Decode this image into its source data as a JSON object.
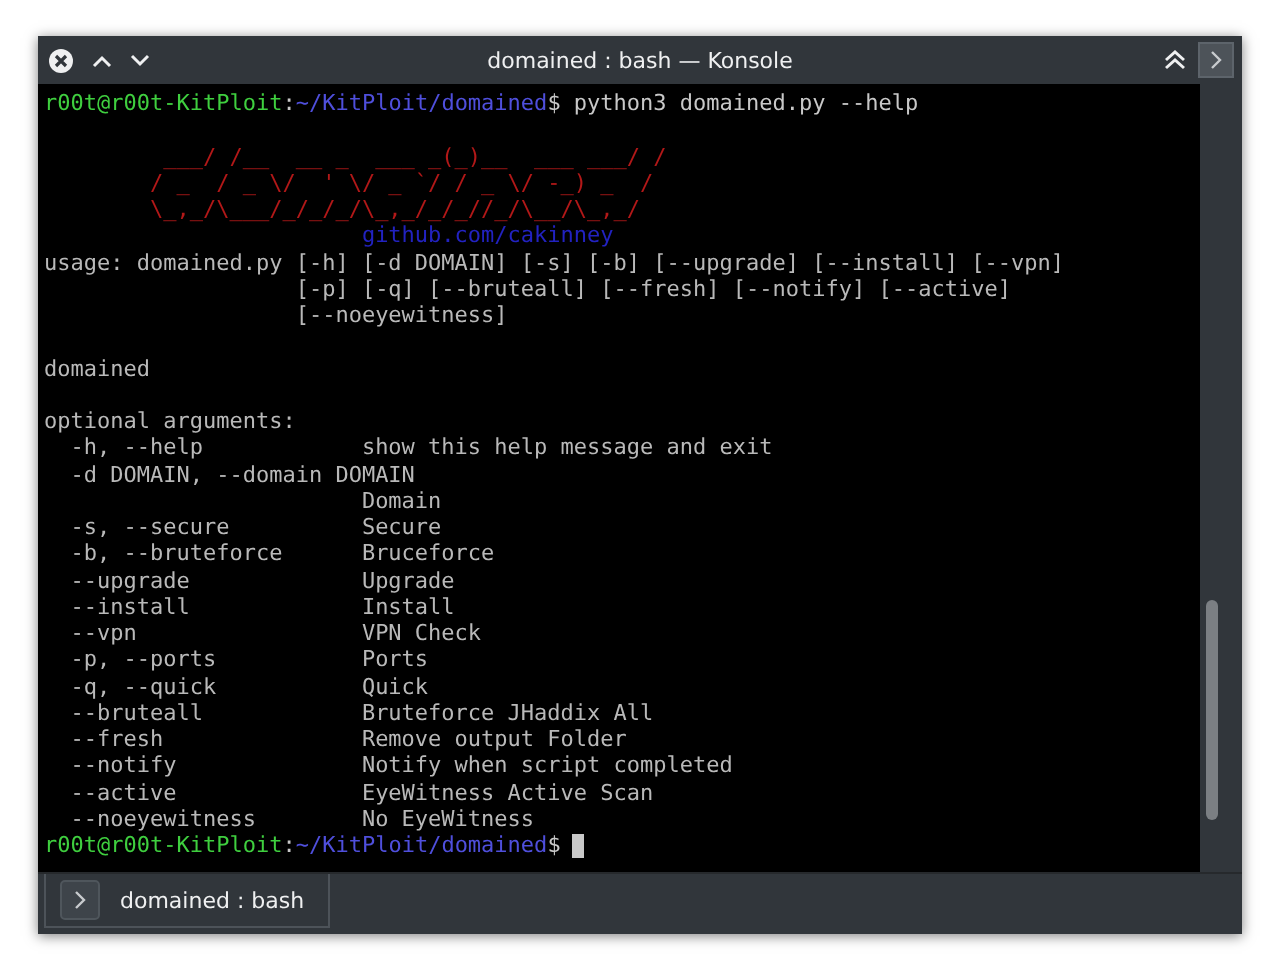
{
  "window": {
    "title": "domained : bash — Konsole"
  },
  "terminal": {
    "lines": [
      {
        "kind": "prompt",
        "segments": [
          {
            "kind": "user",
            "text": "r00t@r00t-KitPloit"
          },
          {
            "kind": "sep",
            "text": ":"
          },
          {
            "kind": "path",
            "text": "~/KitPloit/domained"
          },
          {
            "kind": "plain",
            "text": "$ python3 domained.py --help"
          }
        ]
      },
      {
        "kind": "blank"
      },
      {
        "kind": "art",
        "text": "         ___/ /__  __ _  ___ _(_)__  ___ ___/ /"
      },
      {
        "kind": "art",
        "text": "        / _  / _ \\/  ' \\/ _ `/ / _ \\/ -_) _  /"
      },
      {
        "kind": "art",
        "text": "        \\_,_/\\___/_/_/_/\\_,_/_/_//_/\\__/\\_,_/"
      },
      {
        "kind": "link",
        "text": "                        github.com/cakinney"
      },
      {
        "kind": "text",
        "text": "usage: domained.py [-h] [-d DOMAIN] [-s] [-b] [--upgrade] [--install] [--vpn]"
      },
      {
        "kind": "text",
        "text": "                   [-p] [-q] [--bruteall] [--fresh] [--notify] [--active]"
      },
      {
        "kind": "text",
        "text": "                   [--noeyewitness]"
      },
      {
        "kind": "blank"
      },
      {
        "kind": "text",
        "text": "domained"
      },
      {
        "kind": "blank"
      },
      {
        "kind": "text",
        "text": "optional arguments:"
      },
      {
        "kind": "text",
        "text": "  -h, --help            show this help message and exit"
      },
      {
        "kind": "text",
        "text": "  -d DOMAIN, --domain DOMAIN"
      },
      {
        "kind": "text",
        "text": "                        Domain"
      },
      {
        "kind": "text",
        "text": "  -s, --secure          Secure"
      },
      {
        "kind": "text",
        "text": "  -b, --bruteforce      Bruceforce"
      },
      {
        "kind": "text",
        "text": "  --upgrade             Upgrade"
      },
      {
        "kind": "text",
        "text": "  --install             Install"
      },
      {
        "kind": "text",
        "text": "  --vpn                 VPN Check"
      },
      {
        "kind": "text",
        "text": "  -p, --ports           Ports"
      },
      {
        "kind": "text",
        "text": "  -q, --quick           Quick"
      },
      {
        "kind": "text",
        "text": "  --bruteall            Bruteforce JHaddix All"
      },
      {
        "kind": "text",
        "text": "  --fresh               Remove output Folder"
      },
      {
        "kind": "text",
        "text": "  --notify              Notify when script completed"
      },
      {
        "kind": "text",
        "text": "  --active              EyeWitness Active Scan"
      },
      {
        "kind": "text",
        "text": "  --noeyewitness        No EyeWitness"
      },
      {
        "kind": "prompt",
        "cursor": true,
        "segments": [
          {
            "kind": "user",
            "text": "r00t@r00t-KitPloit"
          },
          {
            "kind": "sep",
            "text": ":"
          },
          {
            "kind": "path",
            "text": "~/KitPloit/domained"
          },
          {
            "kind": "plain",
            "text": "$"
          }
        ]
      }
    ]
  },
  "tabs": [
    {
      "label": "domained : bash",
      "selected": true
    }
  ]
}
